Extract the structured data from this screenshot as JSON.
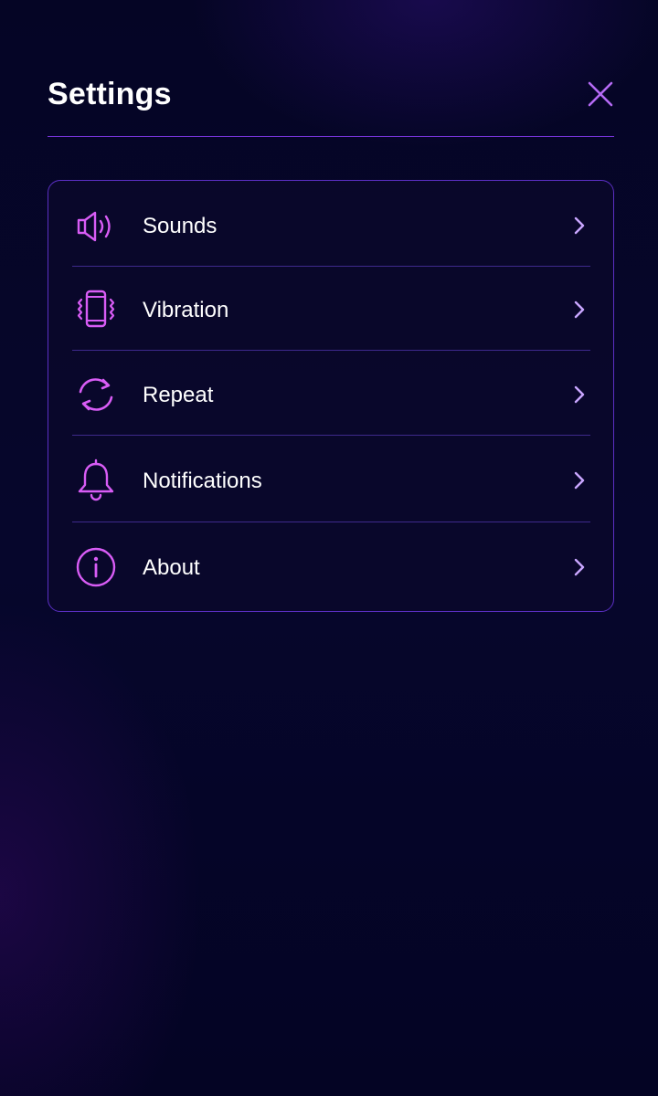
{
  "header": {
    "title": "Settings",
    "close_icon": "close-icon"
  },
  "settings_list": {
    "items": [
      {
        "label": "Sounds",
        "icon": "speaker-icon"
      },
      {
        "label": "Vibration",
        "icon": "phone-vibrate-icon"
      },
      {
        "label": "Repeat",
        "icon": "repeat-icon"
      },
      {
        "label": "Notifications",
        "icon": "bell-icon"
      },
      {
        "label": "About",
        "icon": "info-icon"
      }
    ],
    "chevron_icon": "chevron-right-icon"
  },
  "colors": {
    "background": "#05052a",
    "accent": "#d85cf5",
    "divider": "#7b35e0",
    "card_border": "#5b2fc4",
    "text": "#ffffff",
    "chevron": "#c9a6ff"
  }
}
